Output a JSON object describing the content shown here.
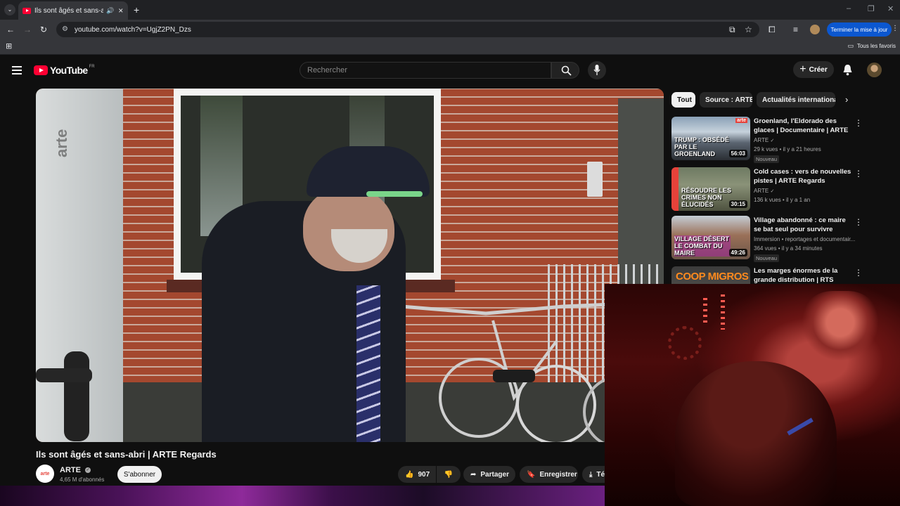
{
  "browser": {
    "tab_title": "Ils sont âgés et sans-abri | A",
    "url": "youtube.com/watch?v=UgjZ2PN_Dzs",
    "update_button": "Terminer la mise à jour",
    "bookmarks_label": "Tous les favoris"
  },
  "youtube": {
    "logo_text": "YouTube",
    "region": "FR",
    "search_placeholder": "Rechercher",
    "create_label": "Créer"
  },
  "player": {
    "watermark": "arte"
  },
  "video": {
    "title": "Ils sont âgés et sans-abri | ARTE Regards",
    "channel": "ARTE",
    "channel_avatar_text": "arte",
    "subscribers": "4,65 M d'abonnés",
    "subscribe_label": "S'abonner",
    "likes": "907",
    "share_label": "Partager",
    "save_label": "Enregistrer",
    "download_label": "Té"
  },
  "chips": [
    "Tout",
    "Source : ARTE",
    "Actualités internationales"
  ],
  "recommendations": [
    {
      "title": "Groenland, l'Eldorado des glaces | Documentaire | ARTE",
      "channel": "ARTE",
      "meta": "29 k vues • il y a 21 heures",
      "badge": "Nouveau",
      "duration": "56:03",
      "thumb_text": "TRUMP : OBSÉDÉ PAR LE GROENLAND"
    },
    {
      "title": "Cold cases : vers de nouvelles pistes | ARTE Regards",
      "channel": "ARTE",
      "meta": "136 k vues • il y a 1 an",
      "badge": "",
      "duration": "30:15",
      "thumb_text": "RÉSOUDRE LES CRIMES NON ÉLUCIDÉS"
    },
    {
      "title": "Village abandonné : ce maire se bat seul pour survivre",
      "channel": "Immersion • reportages et documentair...",
      "meta": "364 vues • il y a 34 minutes",
      "badge": "Nouveau",
      "duration": "49:26",
      "thumb_text": "VILLAGE DÉSERT LE COMBAT DU MAIRE"
    },
    {
      "title": "Les marges énormes de la grande distribution | RTS",
      "channel": "",
      "meta": "",
      "badge": "",
      "duration": "",
      "thumb_text": "COOP MIGROS"
    }
  ]
}
